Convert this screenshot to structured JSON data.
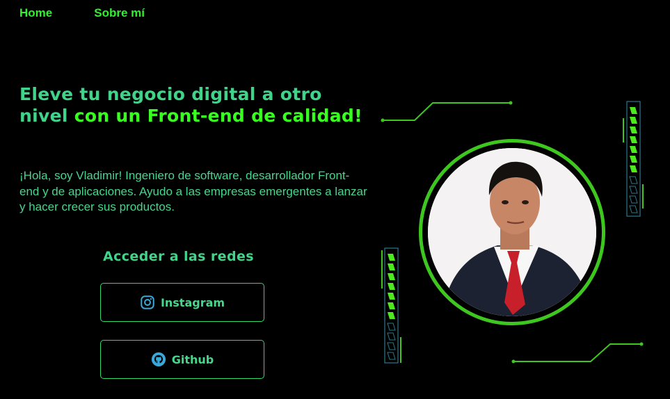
{
  "nav": {
    "home": "Home",
    "about": "Sobre mí"
  },
  "hero": {
    "headline_part1": "Eleve tu negocio digital a otro nivel",
    "headline_part2": "con un Front-end de calidad!",
    "intro": "¡Hola, soy Vladimir! Ingeniero de software, desarrollador Front-end y de aplicaciones. Ayudo a las empresas emergentes a lanzar y hacer crecer sus productos."
  },
  "social": {
    "title": "Acceder a las redes",
    "instagram_label": "Instagram",
    "github_label": "Github"
  },
  "icons": {
    "instagram": "instagram-icon",
    "github": "github-icon"
  },
  "colors": {
    "background": "#000000",
    "accent_green": "#38ff20",
    "teal_green": "#3fd48a",
    "ring_green": "#3ec81f",
    "icon_blue": "#3aa8d8"
  }
}
